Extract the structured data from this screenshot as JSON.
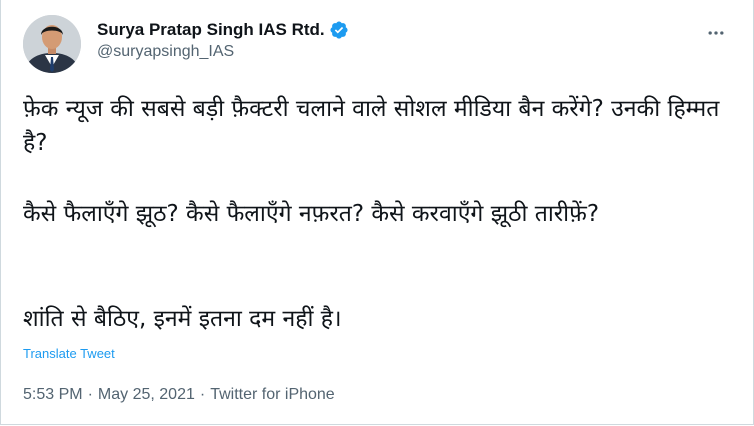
{
  "author": {
    "name": "Surya Pratap Singh IAS Rtd.",
    "handle": "@suryapsingh_IAS",
    "verified": true
  },
  "tweet": {
    "paragraphs": [
      "फ़ेक न्यूज की सबसे बड़ी फ़ैक्टरी चलाने वाले सोशल मीडिया बैन करेंगे? उनकी हिम्मत है?",
      "कैसे फैलाएँगे झूठ? कैसे फैलाएँगे नफ़रत? कैसे करवाएँगे झूठी तारीफ़ें?",
      "शांति से बैठिए, इनमें इतना दम नहीं है।"
    ],
    "translate_label": "Translate Tweet"
  },
  "meta": {
    "time": "5:53 PM",
    "date": "May 25, 2021",
    "source": "Twitter for iPhone",
    "separator": "·"
  },
  "colors": {
    "link": "#1d9bf0",
    "secondary_text": "#536471",
    "verified_badge": "#1d9bf0"
  },
  "icons": {
    "more": "more-horizontal-icon",
    "verified": "verified-badge-icon"
  }
}
